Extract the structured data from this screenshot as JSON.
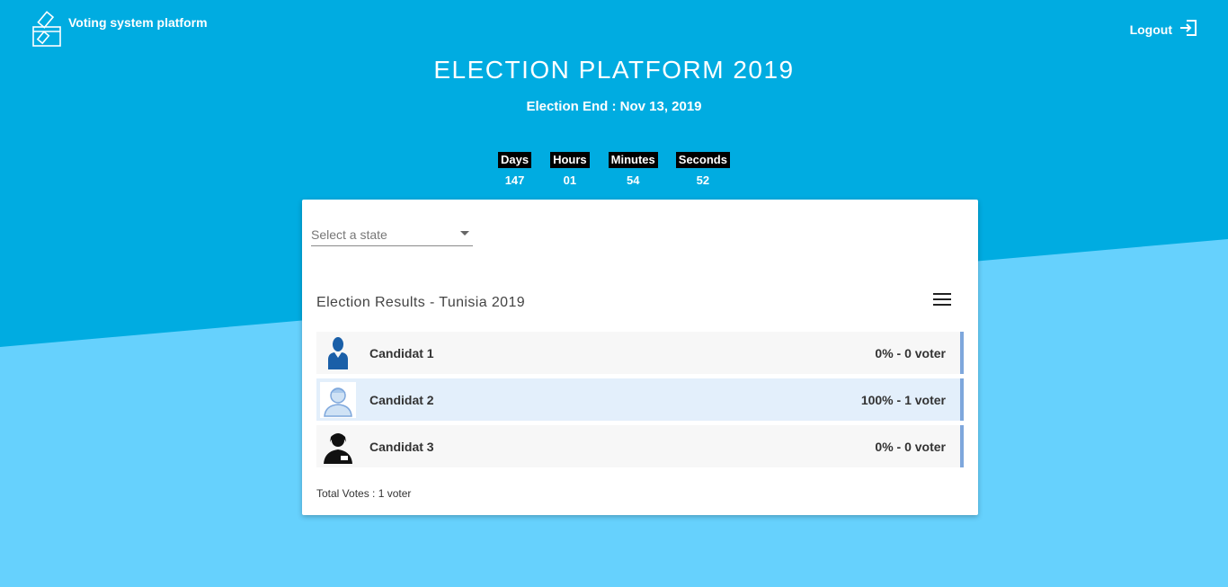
{
  "colors": {
    "top_bg": "#00ace1",
    "bottom_bg": "#66d1fd",
    "row_accent": "#7ea7dc"
  },
  "header": {
    "brand_name": "Voting system platform",
    "logout_label": "Logout",
    "title": "ELECTION PLATFORM 2019",
    "subtitle": "Election End : Nov 13, 2019"
  },
  "countdown": {
    "days_label": "Days",
    "days_value": "147",
    "hours_label": "Hours",
    "hours_value": "01",
    "minutes_label": "Minutes",
    "minutes_value": "54",
    "seconds_label": "Seconds",
    "seconds_value": "52"
  },
  "card": {
    "state_select_placeholder": "Select a state",
    "results_title": "Election Results - Tunisia 2019",
    "candidates": [
      {
        "name": "Candidat 1",
        "result": "0% - 0 voter",
        "icon": "person-blue-icon"
      },
      {
        "name": "Candidat 2",
        "result": "100% - 1 voter",
        "icon": "person-outline-icon"
      },
      {
        "name": "Candidat 3",
        "result": "0% - 0 voter",
        "icon": "person-black-icon"
      }
    ],
    "total_votes": "Total Votes : 1 voter"
  }
}
